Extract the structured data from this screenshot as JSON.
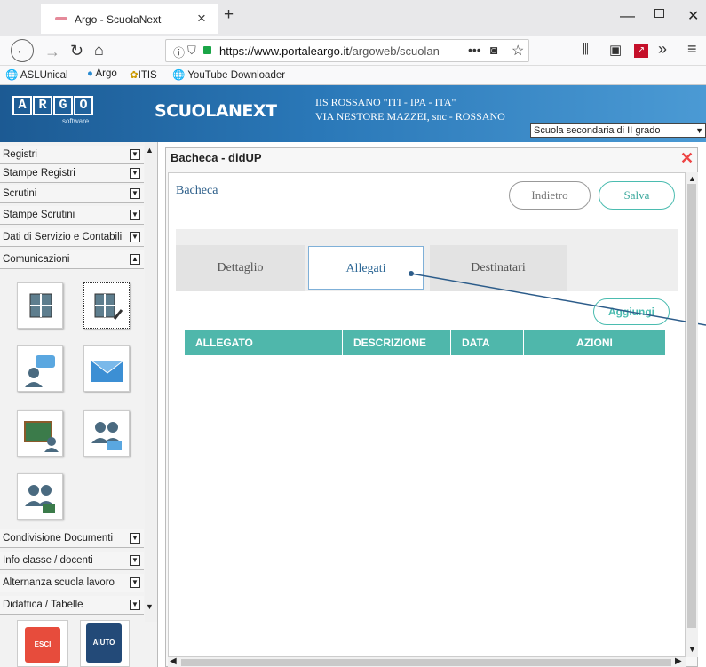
{
  "browser": {
    "tab_title": "Argo - ScuolaNext",
    "url_host": "https://www.portaleargo.it",
    "url_path": "/argoweb/scuolan",
    "bookmarks": [
      {
        "label": "ASLUnical"
      },
      {
        "label": "Argo"
      },
      {
        "label": "ITIS"
      },
      {
        "label": "YouTube Downloader"
      }
    ]
  },
  "header": {
    "logo_letters": [
      "A",
      "R",
      "G",
      "O"
    ],
    "logo_sub": "software",
    "app_name": "SCUOLANEXT",
    "school_line1": "IIS ROSSANO \"ITI - IPA - ITA\"",
    "school_line2": "VIA NESTORE MAZZEI, snc - ROSSANO",
    "school_select": "Scuola secondaria di II grado"
  },
  "sidebar": {
    "items_top": [
      {
        "label": "Registri"
      },
      {
        "label": "Stampe Registri"
      },
      {
        "label": "Scrutini"
      },
      {
        "label": "Stampe Scrutini"
      },
      {
        "label": "Dati di Servizio e Contabili"
      },
      {
        "label": "Comunicazioni"
      }
    ],
    "items_bottom": [
      {
        "label": "Condivisione Documenti"
      },
      {
        "label": "Info classe / docenti"
      },
      {
        "label": "Alternanza scuola lavoro"
      },
      {
        "label": "Didattica / Tabelle"
      }
    ],
    "esci": "ESCI",
    "aiuto": "AIUTO"
  },
  "panel": {
    "title": "Bacheca - didUP",
    "section": "Bacheca",
    "btn_back": "Indietro",
    "btn_save": "Salva",
    "tabs": [
      {
        "label": "Dettaglio"
      },
      {
        "label": "Allegati"
      },
      {
        "label": "Destinatari"
      }
    ],
    "btn_add": "Aggiungi",
    "columns": [
      "ALLEGATO",
      "DESCRIZIONE",
      "DATA",
      "AZIONI"
    ]
  }
}
